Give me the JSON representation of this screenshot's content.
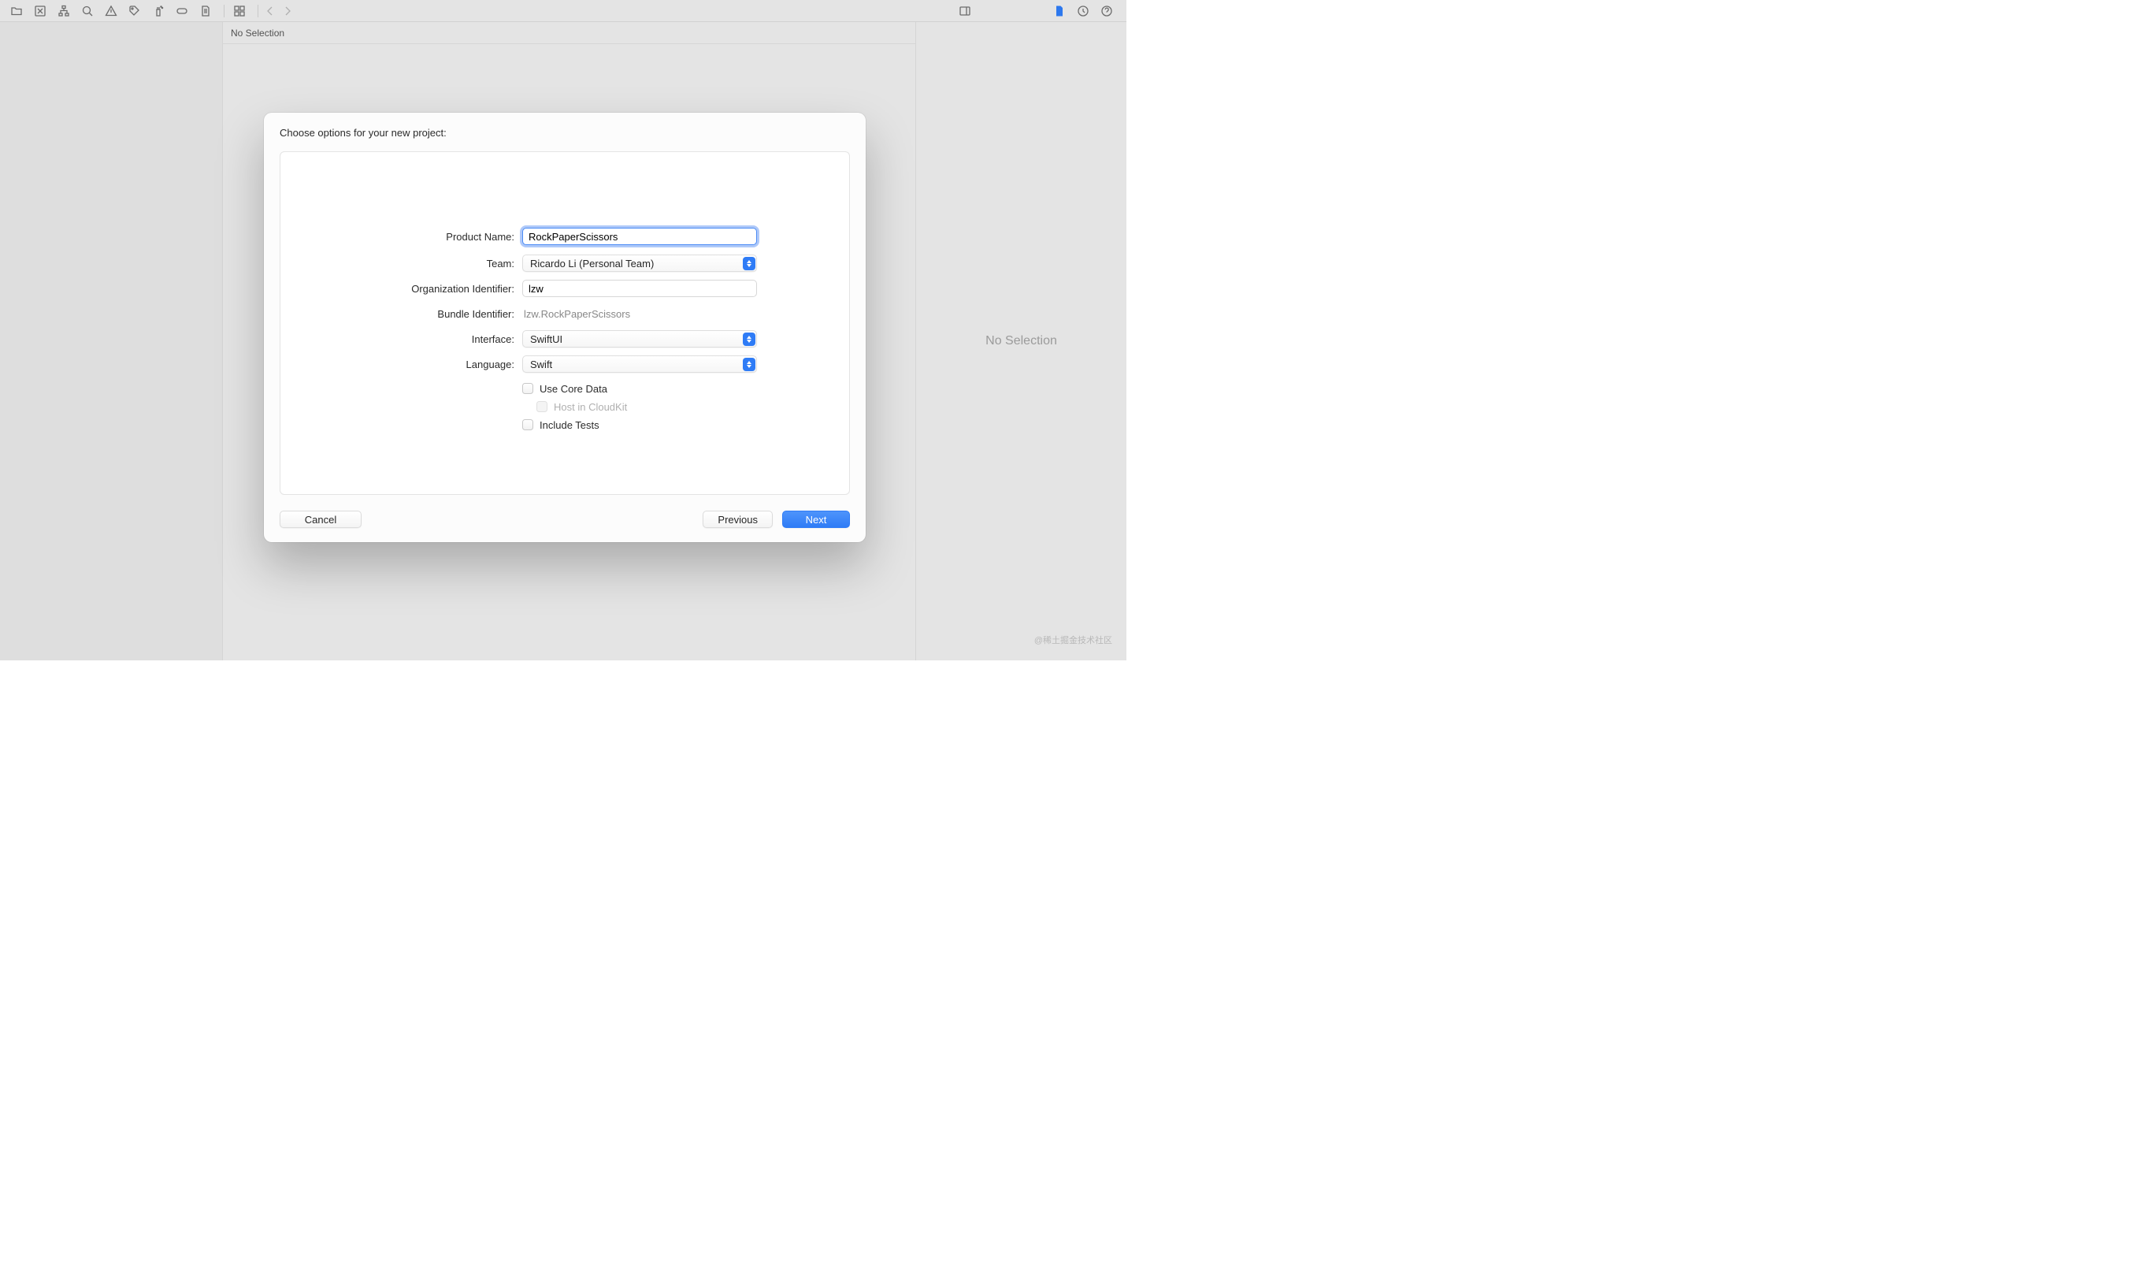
{
  "toolbar": {
    "icons": [
      "folder-icon",
      "close-box-icon",
      "hierarchy-icon",
      "search-icon",
      "warning-icon",
      "tag-icon",
      "spray-icon",
      "pill-icon",
      "document-icon"
    ],
    "group_icon": "grid-icon",
    "nav_back_icon": "chevron-left-icon",
    "nav_forward_icon": "chevron-right-icon",
    "right_icons": [
      "panel-toggle-icon"
    ],
    "far_right_icons": [
      "document-blue-icon",
      "history-icon",
      "help-icon"
    ]
  },
  "editor": {
    "header_text": "No Selection"
  },
  "inspector": {
    "no_selection_text": "No Selection"
  },
  "modal": {
    "title": "Choose options for your new project:",
    "fields": {
      "product_name": {
        "label": "Product Name:",
        "value": "RockPaperScissors"
      },
      "team": {
        "label": "Team:",
        "value": "Ricardo Li (Personal Team)"
      },
      "organization_identifier": {
        "label": "Organization Identifier:",
        "value": "lzw"
      },
      "bundle_identifier": {
        "label": "Bundle Identifier:",
        "value": "lzw.RockPaperScissors"
      },
      "interface": {
        "label": "Interface:",
        "value": "SwiftUI"
      },
      "language": {
        "label": "Language:",
        "value": "Swift"
      }
    },
    "checkboxes": {
      "use_core_data": {
        "label": "Use Core Data",
        "checked": false
      },
      "host_in_cloudkit": {
        "label": "Host in CloudKit",
        "checked": false,
        "disabled": true
      },
      "include_tests": {
        "label": "Include Tests",
        "checked": false
      }
    },
    "buttons": {
      "cancel": "Cancel",
      "previous": "Previous",
      "next": "Next"
    }
  },
  "watermark": "@稀土掘金技术社区"
}
